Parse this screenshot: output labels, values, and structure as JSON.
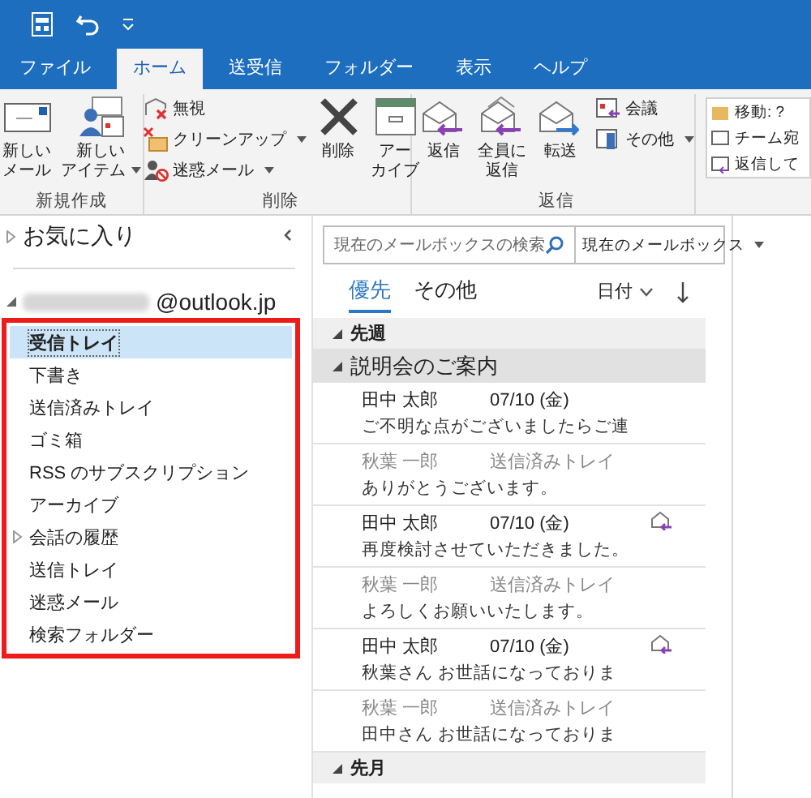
{
  "tabs": [
    {
      "label": "ファイル",
      "selected": false
    },
    {
      "label": "ホーム",
      "selected": true
    },
    {
      "label": "送受信",
      "selected": false
    },
    {
      "label": "フォルダー",
      "selected": false
    },
    {
      "label": "表示",
      "selected": false
    },
    {
      "label": "ヘルプ",
      "selected": false
    }
  ],
  "ribbon": {
    "groups": [
      {
        "label": "新規作成",
        "buttons": [
          {
            "lines": [
              "新しい",
              "メール"
            ],
            "dropdown": false
          },
          {
            "lines": [
              "新しい",
              "アイテム"
            ],
            "dropdown": true
          }
        ]
      },
      {
        "label": "削除",
        "small_buttons": [
          {
            "label": "無視",
            "dropdown": false
          },
          {
            "label": "クリーンアップ",
            "dropdown": true
          },
          {
            "label": "迷惑メール",
            "dropdown": true
          }
        ],
        "buttons": [
          {
            "lines": [
              "削除"
            ],
            "dropdown": false
          },
          {
            "lines": [
              "アー",
              "カイブ"
            ],
            "dropdown": false
          }
        ]
      },
      {
        "label": "返信",
        "buttons": [
          {
            "lines": [
              "返信"
            ],
            "dropdown": false
          },
          {
            "lines": [
              "全員に",
              "返信"
            ],
            "dropdown": false
          },
          {
            "lines": [
              "転送"
            ],
            "dropdown": false
          }
        ],
        "small_buttons": [
          {
            "label": "会議",
            "dropdown": false
          },
          {
            "label": "その他",
            "dropdown": true
          }
        ]
      }
    ],
    "quick_steps": [
      "移動: ?",
      "チーム宛",
      "返信して"
    ]
  },
  "folder_pane": {
    "favorites": {
      "label": "お気に入り",
      "expanded": false
    },
    "account": {
      "label": "@outlook.jp",
      "expanded": true
    },
    "highlighted": true,
    "folders": [
      {
        "label": "受信トレイ",
        "selected": true,
        "has_children": false
      },
      {
        "label": "下書き",
        "selected": false,
        "has_children": false
      },
      {
        "label": "送信済みトレイ",
        "selected": false,
        "has_children": false
      },
      {
        "label": "ゴミ箱",
        "selected": false,
        "has_children": false
      },
      {
        "label": "RSS のサブスクリプション",
        "selected": false,
        "has_children": false
      },
      {
        "label": "アーカイブ",
        "selected": false,
        "has_children": false
      },
      {
        "label": "会話の履歴",
        "selected": false,
        "has_children": true
      },
      {
        "label": "送信トレイ",
        "selected": false,
        "has_children": false
      },
      {
        "label": "迷惑メール",
        "selected": false,
        "has_children": false
      },
      {
        "label": "検索フォルダー",
        "selected": false,
        "has_children": false
      }
    ]
  },
  "message_list": {
    "search": {
      "placeholder": "現在のメールボックスの検索",
      "scope": "現在のメールボックス"
    },
    "tabs": [
      {
        "label": "優先",
        "selected": true
      },
      {
        "label": "その他",
        "selected": false
      }
    ],
    "sort": {
      "label": "日付"
    },
    "rows": [
      {
        "kind": "group",
        "label": "先週",
        "expanded": true
      },
      {
        "kind": "conversation",
        "label": "説明会のご案内",
        "expanded": true
      },
      {
        "kind": "received",
        "sender": "田中 太郎",
        "date": "07/10 (金)",
        "preview": "ご不明な点がございましたらご連",
        "replied": false
      },
      {
        "kind": "sent",
        "sender": "秋葉 一郎",
        "folder": "送信済みトレイ",
        "preview": "ありがとうございます。"
      },
      {
        "kind": "received",
        "sender": "田中 太郎",
        "date": "07/10 (金)",
        "preview": "再度検討させていただきました。",
        "replied": true
      },
      {
        "kind": "sent",
        "sender": "秋葉 一郎",
        "folder": "送信済みトレイ",
        "preview": "よろしくお願いいたします。"
      },
      {
        "kind": "received",
        "sender": "田中 太郎",
        "date": "07/10 (金)",
        "preview": "秋葉さん お世話になっておりま",
        "replied": true
      },
      {
        "kind": "sent",
        "sender": "秋葉 一郎",
        "folder": "送信済みトレイ",
        "preview": "田中さん お世話になっておりま"
      },
      {
        "kind": "group",
        "label": "先月",
        "expanded": true
      }
    ]
  }
}
